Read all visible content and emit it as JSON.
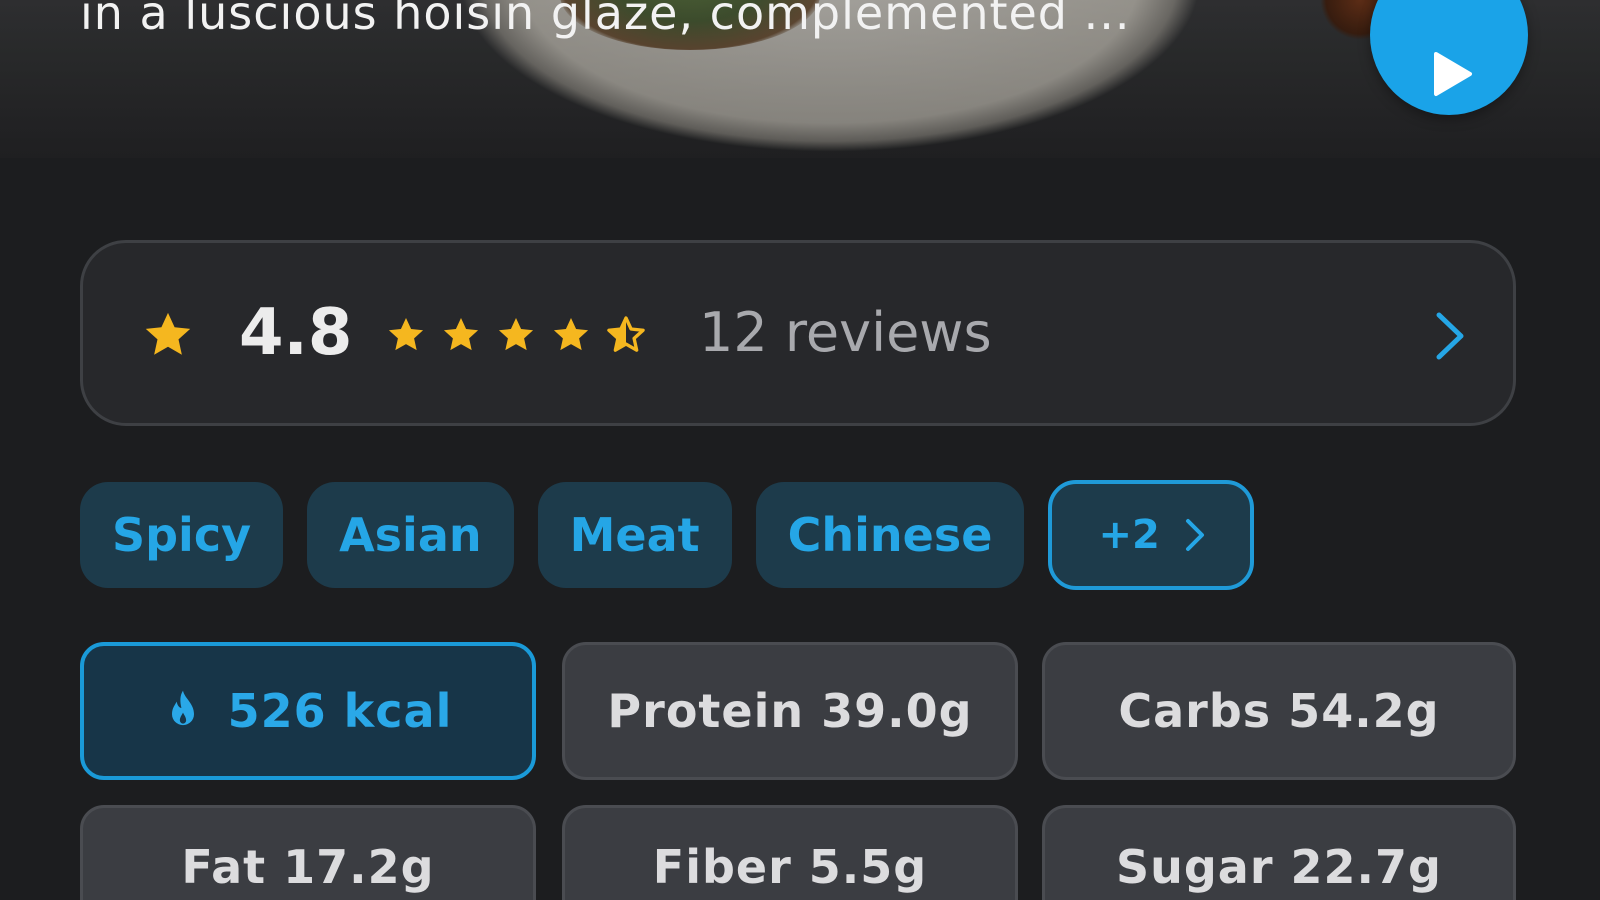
{
  "hero": {
    "description": "in a luscious hoisin glaze, complemented ...",
    "play_icon": "play-icon"
  },
  "rating": {
    "value": "4.8",
    "score": 4.8,
    "max_stars": 5,
    "reviews_label": "12 reviews",
    "star_color": "#f5b71f",
    "chevron_icon": "chevron-right-icon"
  },
  "tags": {
    "items": [
      "Spicy",
      "Asian",
      "Meat",
      "Chinese"
    ],
    "more_label": "+2"
  },
  "nutrition": {
    "calories": "526 kcal",
    "protein": "Protein 39.0g",
    "carbs": "Carbs 54.2g",
    "fat": "Fat 17.2g",
    "fiber": "Fiber 5.5g",
    "sugar": "Sugar 22.7g",
    "calorie_icon": "flame-icon"
  },
  "colors": {
    "accent": "#1aa3e8",
    "background": "#1c1d1f"
  }
}
